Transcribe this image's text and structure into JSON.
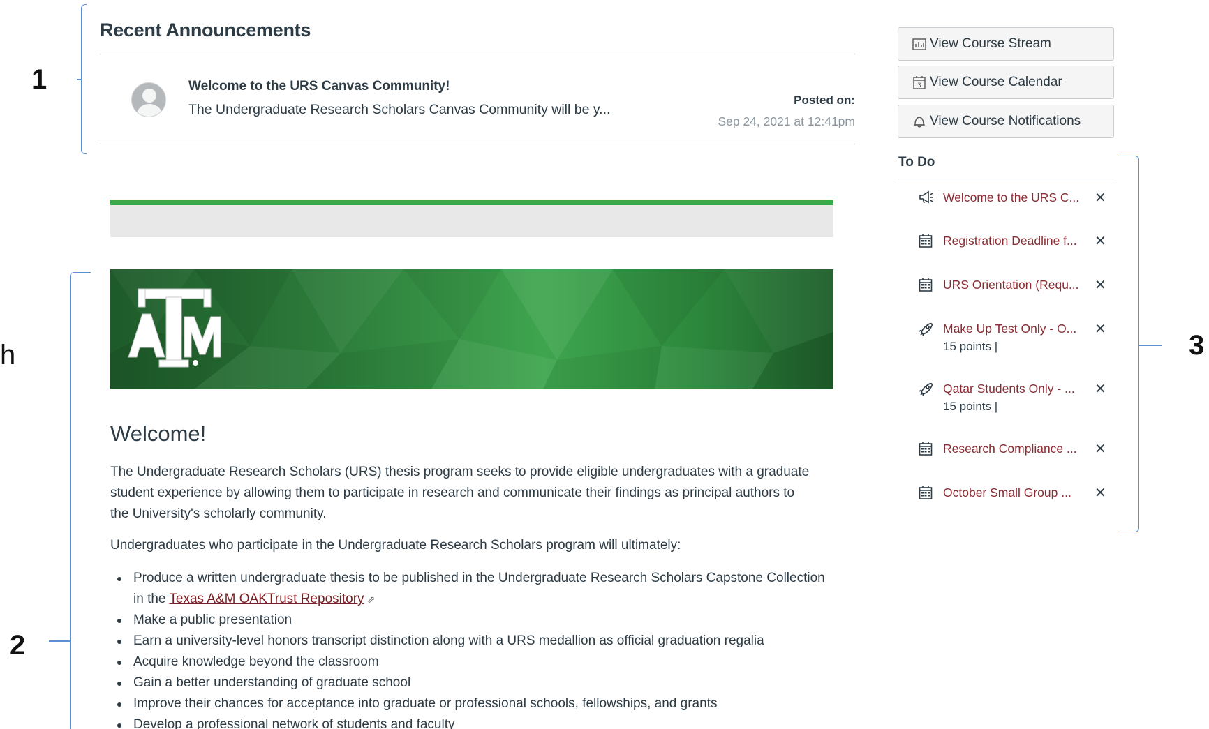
{
  "annotations": {
    "label_1": "1",
    "label_2": "2",
    "label_3": "3",
    "label_h": "h"
  },
  "announcements": {
    "heading": "Recent Announcements",
    "item": {
      "title": "Welcome to the URS Canvas Community!",
      "message": "The Undergraduate Research Scholars Canvas Community will be y...",
      "posted_label": "Posted on:",
      "posted_date": "Sep 24, 2021 at 12:41pm"
    }
  },
  "banner": {
    "logo_alt": "ATM"
  },
  "welcome": {
    "heading": "Welcome!",
    "paragraph_1": "The Undergraduate Research Scholars (URS) thesis program seeks to provide eligible undergraduates with a graduate student experience by allowing them to participate in research and communicate their findings as principal authors to the University's scholarly community.",
    "paragraph_2": "Undergraduates who participate in the Undergraduate Research Scholars program will ultimately:",
    "bullet_1_prefix": "Produce a written undergraduate thesis to be published in the Undergraduate Research Scholars Capstone Collection in the ",
    "bullet_1_link": "Texas A&M OAKTrust Repository",
    "bullets": [
      "Make a public presentation",
      "Earn a university-level honors transcript distinction along with a URS medallion as official graduation regalia",
      "Acquire knowledge beyond the classroom",
      "Gain a better understanding of graduate school",
      "Improve their chances for acceptance into graduate or professional schools, fellowships, and grants",
      "Develop a professional network of students and faculty"
    ]
  },
  "sidebar": {
    "buttons": {
      "stream": "View Course Stream",
      "calendar": "View Course Calendar",
      "notifications": "View Course Notifications"
    },
    "todo_heading": "To Do",
    "todo": [
      {
        "icon": "announcement-icon",
        "text": "Welcome to the URS C...",
        "sub": ""
      },
      {
        "icon": "calendar-icon",
        "text": "Registration Deadline f...",
        "sub": ""
      },
      {
        "icon": "calendar-icon",
        "text": "URS Orientation (Requ...",
        "sub": ""
      },
      {
        "icon": "quiz-rocket-icon",
        "text": "Make Up Test Only - O...",
        "sub": "15 points  |"
      },
      {
        "icon": "quiz-rocket-icon",
        "text": "Qatar Students Only - ...",
        "sub": "15 points  |"
      },
      {
        "icon": "calendar-icon",
        "text": "Research Compliance ...",
        "sub": ""
      },
      {
        "icon": "calendar-icon",
        "text": "October Small Group ...",
        "sub": ""
      }
    ],
    "dismiss_glyph": "✕"
  },
  "colors": {
    "text": "#2d3b45",
    "link_maroon": "#8b2b33",
    "accent_green": "#3aaa4a",
    "annotation_blue": "#5b8fd6"
  }
}
